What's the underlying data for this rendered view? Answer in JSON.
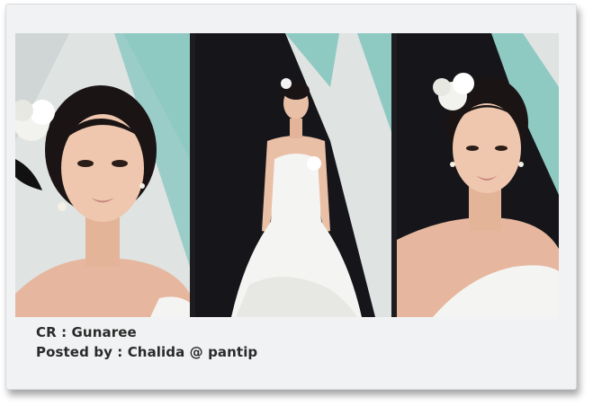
{
  "caption": {
    "credit": "CR : Gunaree",
    "posted_by": "Posted by : Chalida @ pantip"
  },
  "photos": [
    {
      "subject": "bride-portrait-left",
      "icon": "portrait-photo"
    },
    {
      "subject": "bride-full-gown",
      "icon": "full-length-photo"
    },
    {
      "subject": "bride-portrait-right",
      "icon": "portrait-photo"
    }
  ],
  "colors": {
    "backdrop_teal": "#8ec9c2",
    "backdrop_light": "#dfe3e2",
    "backdrop_dark": "#16151a",
    "gown_white": "#f4f4f2",
    "skin": "#e9bfa6",
    "hair": "#1a1414"
  }
}
